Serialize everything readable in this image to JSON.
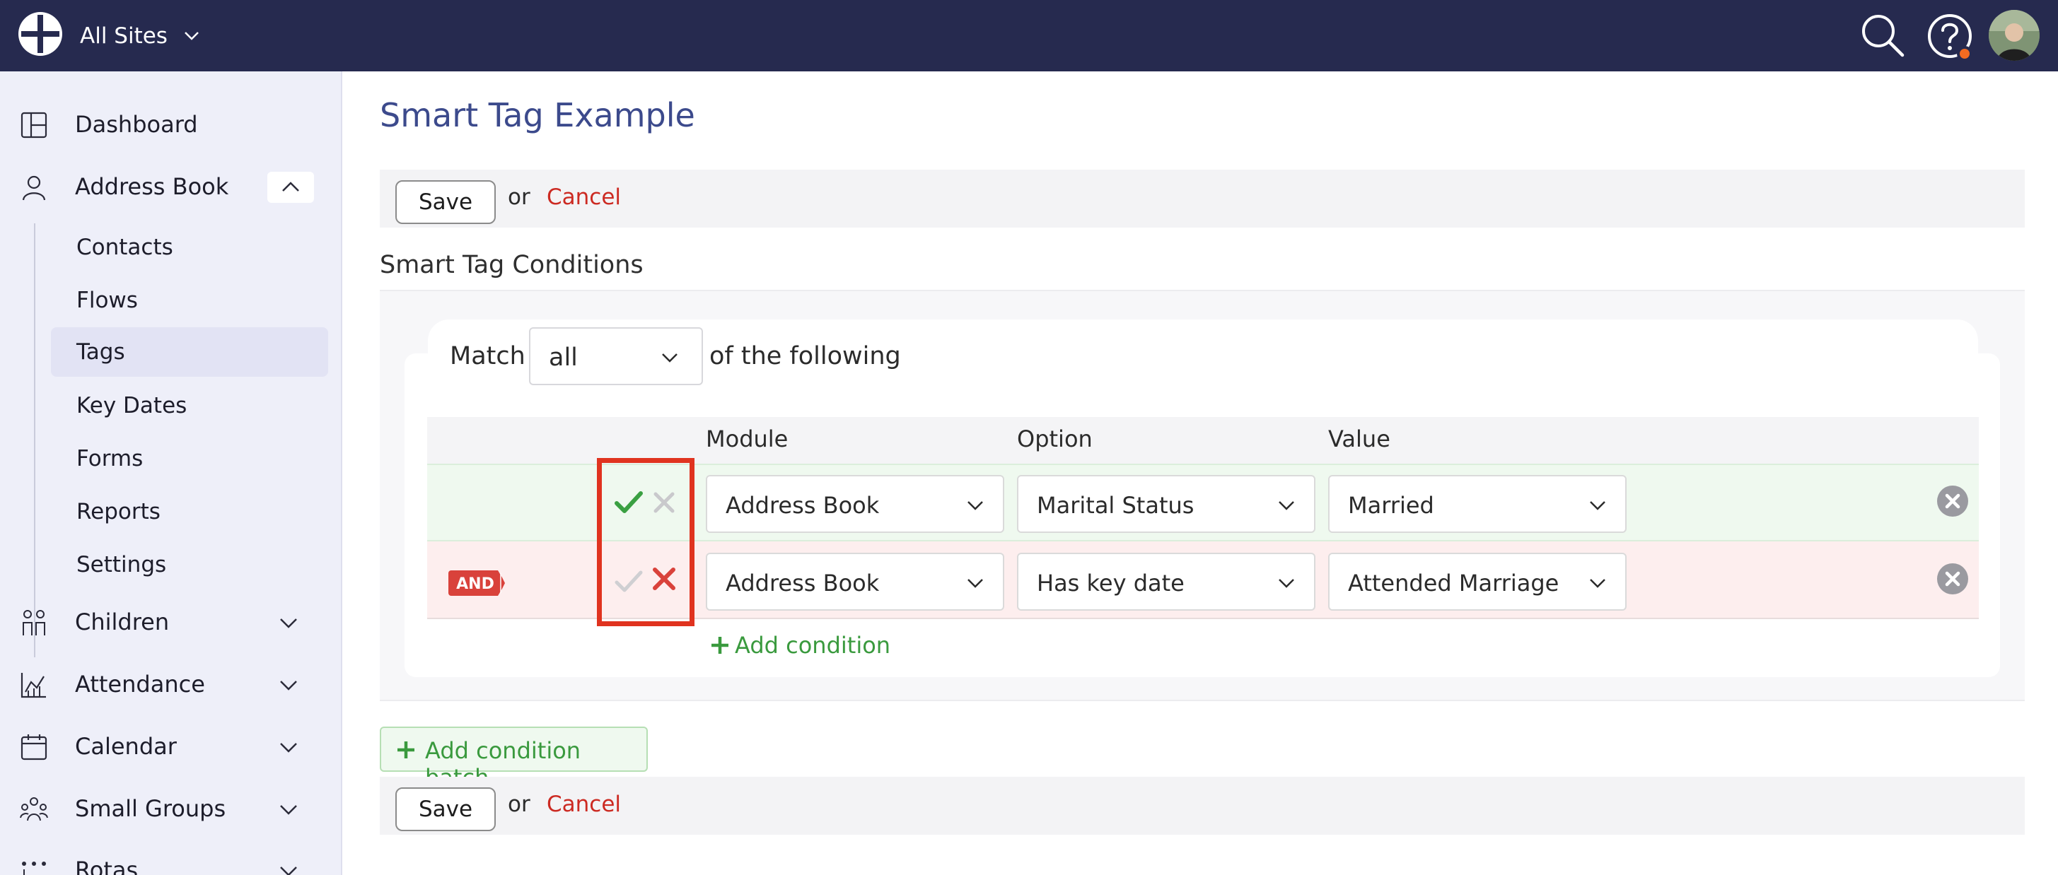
{
  "app": {
    "site_selector": "All Sites",
    "accent_color": "#262a4f",
    "notification_dot_color": "#f26b21"
  },
  "sidebar": {
    "items": [
      {
        "label": "Dashboard",
        "icon": "dashboard-icon"
      },
      {
        "label": "Address Book",
        "icon": "person-icon",
        "expanded": true
      },
      {
        "label": "Children",
        "icon": "children-icon"
      },
      {
        "label": "Attendance",
        "icon": "chart-icon"
      },
      {
        "label": "Calendar",
        "icon": "calendar-icon"
      },
      {
        "label": "Small Groups",
        "icon": "groups-icon"
      },
      {
        "label": "Rotas",
        "icon": "rotas-icon"
      }
    ],
    "address_book_sub": [
      {
        "label": "Contacts"
      },
      {
        "label": "Flows"
      },
      {
        "label": "Tags",
        "active": true
      },
      {
        "label": "Key Dates"
      },
      {
        "label": "Forms"
      },
      {
        "label": "Reports"
      },
      {
        "label": "Settings"
      }
    ]
  },
  "page": {
    "title": "Smart Tag Example",
    "save_label": "Save",
    "or_label": "or",
    "cancel_label": "Cancel",
    "section_title": "Smart Tag Conditions"
  },
  "conditions": {
    "match_label": "Match",
    "match_value": "all",
    "following_label": "of the following",
    "columns": {
      "module": "Module",
      "option": "Option",
      "value": "Value"
    },
    "rows": [
      {
        "state": "true",
        "module": "Address Book",
        "option": "Marital Status",
        "value": "Married"
      },
      {
        "state": "false",
        "connector": "AND",
        "module": "Address Book",
        "option": "Has key date",
        "value": "Attended Marriage Co"
      }
    ],
    "add_condition_label": "Add condition",
    "add_batch_label": "Add condition batch"
  }
}
